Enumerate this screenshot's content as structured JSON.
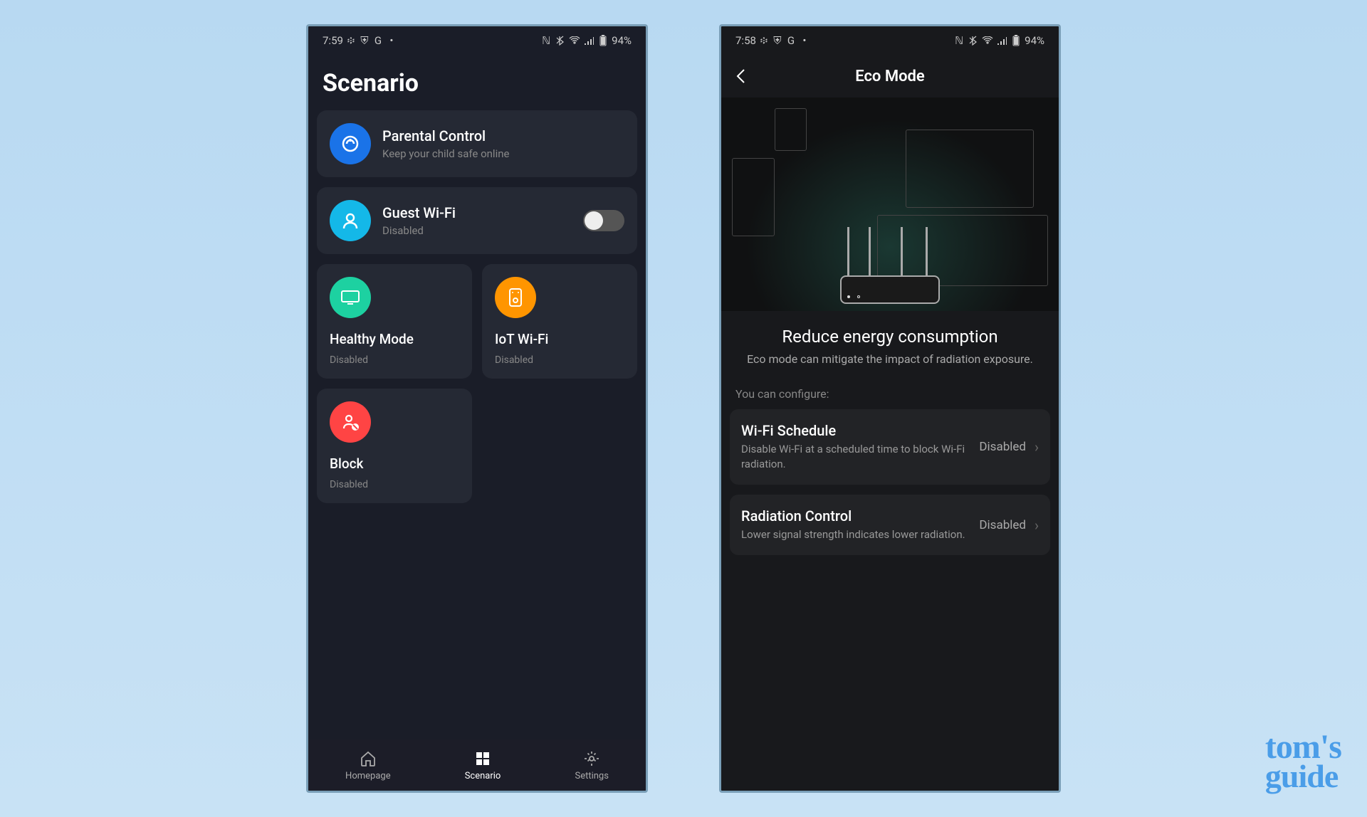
{
  "left": {
    "status": {
      "time": "7:59",
      "battery": "94%"
    },
    "page_title": "Scenario",
    "parental": {
      "title": "Parental Control",
      "subtitle": "Keep your child safe online"
    },
    "guest": {
      "title": "Guest Wi-Fi",
      "subtitle": "Disabled"
    },
    "healthy": {
      "title": "Healthy Mode",
      "subtitle": "Disabled"
    },
    "iot": {
      "title": "IoT Wi-Fi",
      "subtitle": "Disabled"
    },
    "block": {
      "title": "Block",
      "subtitle": "Disabled"
    },
    "nav": {
      "homepage": "Homepage",
      "scenario": "Scenario",
      "settings": "Settings"
    }
  },
  "right": {
    "status": {
      "time": "7:58",
      "battery": "94%"
    },
    "header_title": "Eco Mode",
    "eco_title": "Reduce energy consumption",
    "eco_sub": "Eco mode can mitigate the impact of radiation exposure.",
    "config_label": "You can configure:",
    "wifi_schedule": {
      "title": "Wi-Fi Schedule",
      "desc": "Disable Wi-Fi at a scheduled time to block Wi-Fi radiation.",
      "status": "Disabled"
    },
    "radiation": {
      "title": "Radiation Control",
      "desc": "Lower signal strength indicates lower radiation.",
      "status": "Disabled"
    }
  },
  "watermark": {
    "line1": "tom's",
    "line2": "guide"
  }
}
